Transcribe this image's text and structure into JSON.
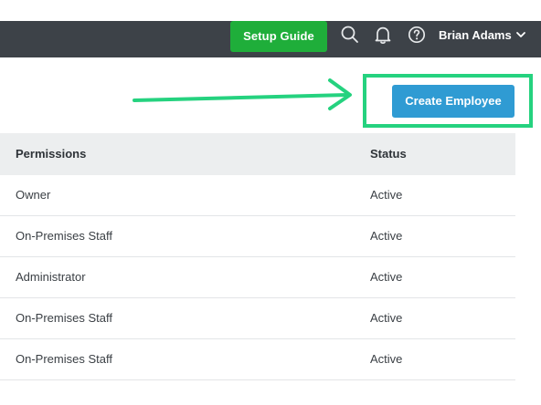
{
  "header": {
    "setup_guide_label": "Setup Guide",
    "user_name": "Brian Adams",
    "icons": [
      "search-icon",
      "bell-icon",
      "help-icon",
      "chevron-down-icon"
    ]
  },
  "actions": {
    "create_employee_label": "Create Employee"
  },
  "table": {
    "columns": [
      "Permissions",
      "Status"
    ],
    "rows": [
      {
        "permissions": "Owner",
        "status": "Active"
      },
      {
        "permissions": "On-Premises Staff",
        "status": "Active"
      },
      {
        "permissions": "Administrator",
        "status": "Active"
      },
      {
        "permissions": "On-Premises Staff",
        "status": "Active"
      },
      {
        "permissions": "On-Premises Staff",
        "status": "Active"
      }
    ]
  },
  "colors": {
    "topbar": "#3d4248",
    "setup_guide": "#1fae3a",
    "create_button": "#2f9bd3",
    "annotation": "#25d27f"
  }
}
